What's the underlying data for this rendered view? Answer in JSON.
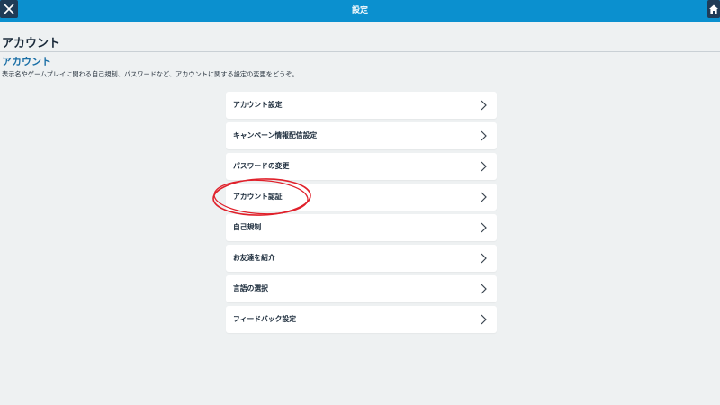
{
  "header": {
    "title": "設定",
    "close_icon": "close-icon",
    "home_icon": "home-icon",
    "bar_color": "#0b90cf"
  },
  "page": {
    "heading": "アカウント",
    "section_heading": "アカウント",
    "description": "表示名やゲームプレイに関わる自己規制、パスワードなど、アカウントに関する設定の変更をどうぞ。"
  },
  "menu": {
    "items": [
      {
        "label": "アカウント設定"
      },
      {
        "label": "キャンペーン情報配信設定"
      },
      {
        "label": "パスワードの変更"
      },
      {
        "label": "アカウント認証"
      },
      {
        "label": "自己規制"
      },
      {
        "label": "お友達を紹介"
      },
      {
        "label": "言語の選択"
      },
      {
        "label": "フィードバック設定"
      }
    ],
    "chevron_icon": "chevron-right-icon"
  },
  "annotation": {
    "color": "#e0202a"
  }
}
